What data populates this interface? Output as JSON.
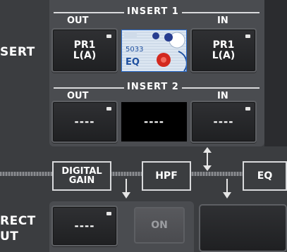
{
  "insert": {
    "side_label": "SERT",
    "insert1": {
      "title": "INSERT 1",
      "out_label": "OUT",
      "in_label": "IN",
      "out_button": "PR1\nL(A)",
      "in_button": "PR1\nL(A)",
      "plugin": {
        "number": "5033",
        "name": "EQ"
      }
    },
    "insert2": {
      "title": "INSERT 2",
      "out_label": "OUT",
      "in_label": "IN",
      "out_button": "----",
      "center_value": "----",
      "in_button": "----"
    }
  },
  "signal_chain": {
    "digital_gain": "DIGITAL\nGAIN",
    "hpf": "HPF",
    "eq": "EQ"
  },
  "direct_out": {
    "side_label_1": "RECT",
    "side_label_2": "UT",
    "patch_button": "----",
    "on_button": "ON"
  },
  "colors": {
    "background": "#3b3d40",
    "panel": "#4a4c50",
    "button": "#1f2022",
    "plugin_border": "#2d6fd1"
  }
}
